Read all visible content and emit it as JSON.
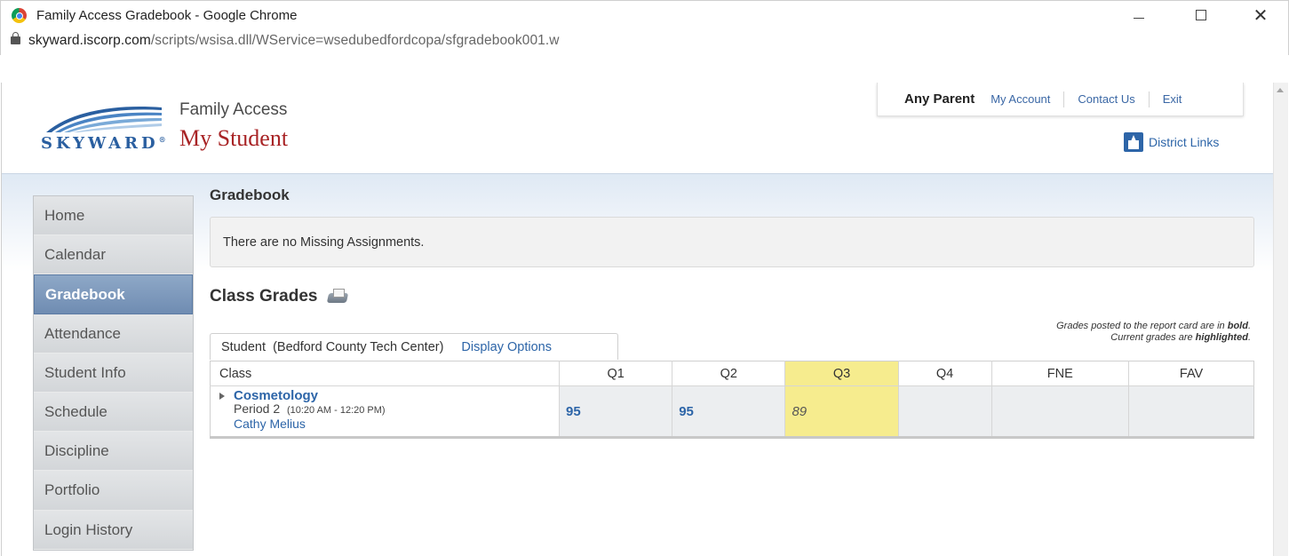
{
  "window": {
    "title": "Family Access Gradebook - Google Chrome",
    "url_host": "skyward.iscorp.com",
    "url_path": "/scripts/wsisa.dll/WService=wsedubedfordcopa/sfgradebook001.w"
  },
  "header": {
    "logo_text": "SKYWARD",
    "app_title": "Family Access",
    "app_subtitle": "My Student",
    "user_name": "Any Parent",
    "my_account": "My Account",
    "contact_us": "Contact Us",
    "exit": "Exit",
    "district_links": "District Links"
  },
  "sidebar": {
    "items": [
      {
        "label": "Home"
      },
      {
        "label": "Calendar"
      },
      {
        "label": "Gradebook",
        "active": true
      },
      {
        "label": "Attendance"
      },
      {
        "label": "Student Info"
      },
      {
        "label": "Schedule"
      },
      {
        "label": "Discipline"
      },
      {
        "label": "Portfolio"
      },
      {
        "label": "Login History"
      }
    ]
  },
  "main": {
    "title": "Gradebook",
    "missing_message": "There are no Missing Assignments.",
    "class_grades_title": "Class Grades",
    "legend_line1_prefix": "Grades posted to the report card are in ",
    "legend_line1_bold": "bold",
    "legend_line1_suffix": ".",
    "legend_line2_prefix": "Current grades are ",
    "legend_line2_bold": "highlighted",
    "legend_line2_suffix": ".",
    "tab_student": "Student",
    "tab_school": "(Bedford County Tech Center)",
    "display_options": "Display Options"
  },
  "table": {
    "columns": [
      "Class",
      "Q1",
      "Q2",
      "Q3",
      "Q4",
      "FNE",
      "FAV"
    ],
    "highlight_color": "#f6ec8e",
    "rows": [
      {
        "class_name": "Cosmetology",
        "period": "Period 2",
        "time": "(10:20 AM - 12:20 PM)",
        "teacher": "Cathy Melius",
        "q1": "95",
        "q2": "95",
        "q3": "89",
        "q4": "",
        "fne": "",
        "fav": ""
      }
    ]
  }
}
